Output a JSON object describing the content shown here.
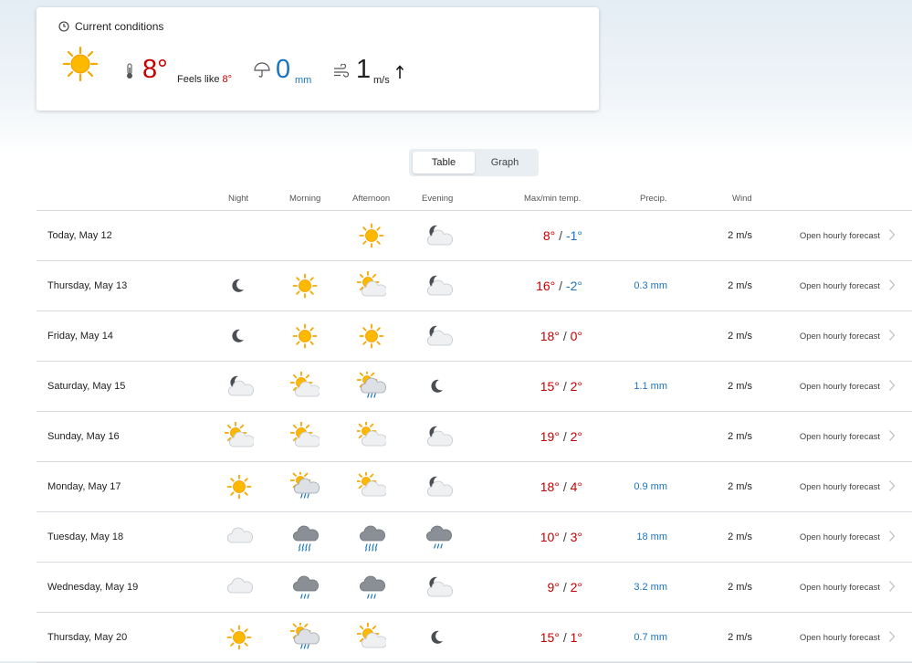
{
  "current": {
    "title": "Current conditions",
    "temperature": "8°",
    "feels_like_label": "Feels like",
    "feels_like_value": "8°",
    "precip_value": "0",
    "precip_unit": "mm",
    "wind_value": "1",
    "wind_unit": "m/s",
    "condition_icon": "sun-icon",
    "wind_direction_icon": "arrow-up-icon"
  },
  "view_toggle": {
    "table": "Table",
    "graph": "Graph",
    "selected": "Table"
  },
  "columns": {
    "night": "Night",
    "morning": "Morning",
    "afternoon": "Afternoon",
    "evening": "Evening",
    "maxmin": "Max/min temp.",
    "precip": "Precip.",
    "wind": "Wind"
  },
  "days": [
    {
      "date": "Today, May 12",
      "night": null,
      "morning": null,
      "afternoon": "sun",
      "evening": "moon-cloud",
      "max": "8°",
      "min": "-1°",
      "precip": "",
      "wind": "2 m/s",
      "link": "Open hourly forecast"
    },
    {
      "date": "Thursday, May 13",
      "night": "moon",
      "morning": "sun",
      "afternoon": "sun-cloud",
      "evening": "moon-cloud",
      "max": "16°",
      "min": "-2°",
      "precip": "0.3 mm",
      "wind": "2 m/s",
      "link": "Open hourly forecast"
    },
    {
      "date": "Friday, May 14",
      "night": "moon",
      "morning": "sun",
      "afternoon": "sun",
      "evening": "moon-cloud",
      "max": "18°",
      "min": "0°",
      "precip": "",
      "wind": "2 m/s",
      "link": "Open hourly forecast"
    },
    {
      "date": "Saturday, May 15",
      "night": "moon-cloud",
      "morning": "sun-cloud",
      "afternoon": "sun-cloud-rain",
      "evening": "moon",
      "max": "15°",
      "min": "2°",
      "precip": "1.1 mm",
      "wind": "2 m/s",
      "link": "Open hourly forecast"
    },
    {
      "date": "Sunday, May 16",
      "night": "sun-cloud",
      "morning": "sun-cloud",
      "afternoon": "sun-cloud-light",
      "evening": "moon-cloud",
      "max": "19°",
      "min": "2°",
      "precip": "",
      "wind": "2 m/s",
      "link": "Open hourly forecast"
    },
    {
      "date": "Monday, May 17",
      "night": "sun",
      "morning": "sun-cloud-rain",
      "afternoon": "sun-cloud-light",
      "evening": "moon-cloud",
      "max": "18°",
      "min": "4°",
      "precip": "0.9 mm",
      "wind": "2 m/s",
      "link": "Open hourly forecast"
    },
    {
      "date": "Tuesday, May 18",
      "night": "cloud",
      "morning": "cloud-heavy-rain",
      "afternoon": "cloud-heavy-rain",
      "evening": "cloud-rain",
      "max": "10°",
      "min": "3°",
      "precip": "18 mm",
      "wind": "2 m/s",
      "link": "Open hourly forecast"
    },
    {
      "date": "Wednesday, May 19",
      "night": "cloud",
      "morning": "cloud-rain",
      "afternoon": "cloud-rain",
      "evening": "moon-cloud",
      "max": "9°",
      "min": "2°",
      "precip": "3.2 mm",
      "wind": "2 m/s",
      "link": "Open hourly forecast"
    },
    {
      "date": "Thursday, May 20",
      "night": "sun",
      "morning": "sun-cloud-rain",
      "afternoon": "sun-cloud",
      "evening": "moon",
      "max": "15°",
      "min": "1°",
      "precip": "0.7 mm",
      "wind": "2 m/s",
      "link": "Open hourly forecast"
    }
  ],
  "colors": {
    "temp_warm": "#c60000",
    "temp_cold": "#1a74c0",
    "precip": "#1a74c0"
  }
}
